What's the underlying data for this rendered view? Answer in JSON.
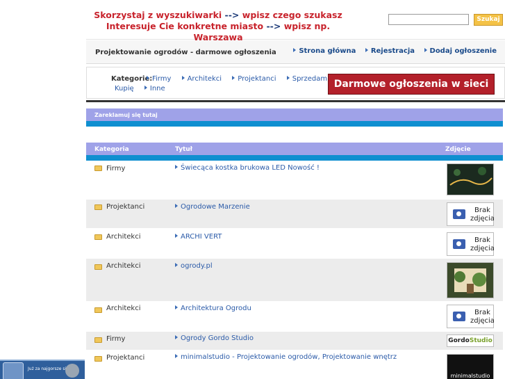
{
  "header": {
    "banner_line1_a": "Skorzystaj z wyszukiwarki",
    "banner_line1_b": "-->",
    "banner_line1_c": "wpisz czego szukasz",
    "banner_line2_a": "Interesuje Cie konkretne miasto",
    "banner_line2_b": "-->",
    "banner_line2_c": "wpisz np. Warszawa",
    "search_value": "",
    "search_button": "Szukaj"
  },
  "titlebar": {
    "page_title": "Projektowanie ogrodów - darmowe ogłoszenia",
    "nav": [
      "Strona główna",
      "Rejestracja",
      "Dodaj ogłoszenie"
    ]
  },
  "categories": {
    "label": "Kategorie:",
    "items": [
      "Firmy",
      "Architekci",
      "Projektanci",
      "Sprzedam",
      "Kupię",
      "Inne"
    ],
    "ad_banner": "Darmowe ogłoszenia w sieci !!"
  },
  "adbar": {
    "label": "Zareklamuj się tutaj"
  },
  "table": {
    "headers": {
      "category": "Kategoria",
      "title": "Tytuł",
      "photo": "Zdjęcie"
    },
    "rows": [
      {
        "category": "Firmy",
        "title": "Świecąca kostka brukowa LED Nowość !",
        "photo": "image"
      },
      {
        "category": "Projektanci",
        "title": "Ogrodowe Marzenie",
        "photo": "none"
      },
      {
        "category": "Architekci",
        "title": "ARCHI VERT",
        "photo": "none"
      },
      {
        "category": "Architekci",
        "title": "ogrody.pl",
        "photo": "image"
      },
      {
        "category": "Architekci",
        "title": "Architektura Ogrodu",
        "photo": "none"
      },
      {
        "category": "Firmy",
        "title": "Ogrody Gordo Studio",
        "photo": "logo"
      },
      {
        "category": "Projektanci",
        "title": "minimalstudio - Projektowanie ogrodów, Projektowanie wnętrz",
        "photo": "minimal"
      }
    ],
    "no_photo_line1": "Brak",
    "no_photo_line2": "zdjęcia",
    "gordo_logo_a": "Gordo",
    "gordo_logo_b": "Studio",
    "minimal_logo": "minimalstudio"
  },
  "widget": {
    "label": "Już za najgorsze się"
  },
  "colors": {
    "header_bar": "#9fa2e8",
    "stripe": "#0f8fd0",
    "link": "#2a5aa8",
    "banner_red": "#c8232c",
    "banner_blue": "#1c3a78",
    "search_button": "#f4c246",
    "ad_banner": "#b3202a"
  }
}
